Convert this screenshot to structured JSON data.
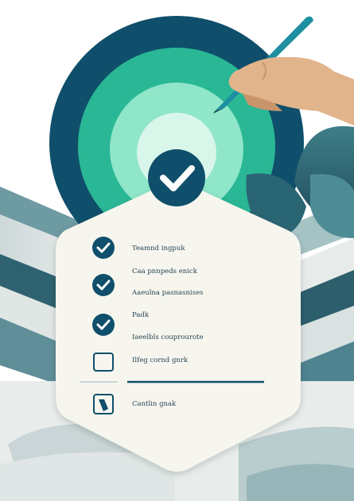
{
  "colors": {
    "navy": "#0f4f6b",
    "teal": "#2ab795",
    "mint": "#8fe6c8",
    "card": "#f7f6ee",
    "skin": "#e2b48c",
    "pen": "#1d8fa0"
  },
  "header_icon": "check-circle-icon",
  "checklist": {
    "items": [
      {
        "label": "Teamnd ingpuk",
        "state": "checked",
        "icon": "check-circle-icon"
      },
      {
        "label": "Caa pnnpeds enick",
        "state": "checked",
        "icon": "check-circle-icon"
      },
      {
        "label": "Aaeulna pasnasnises",
        "state": "checked",
        "icon": "check-circle-icon"
      },
      {
        "label": "Padk",
        "state": "checked",
        "icon": "check-circle-icon"
      },
      {
        "label": "Iaeelbls couprourote",
        "state": "none",
        "icon": ""
      },
      {
        "label": "Ilfeg cornd gnrk",
        "state": "unchecked",
        "icon": "empty-checkbox-icon"
      },
      {
        "label": "Cantlin gnak",
        "state": "partial",
        "icon": "pen-box-icon"
      }
    ]
  }
}
